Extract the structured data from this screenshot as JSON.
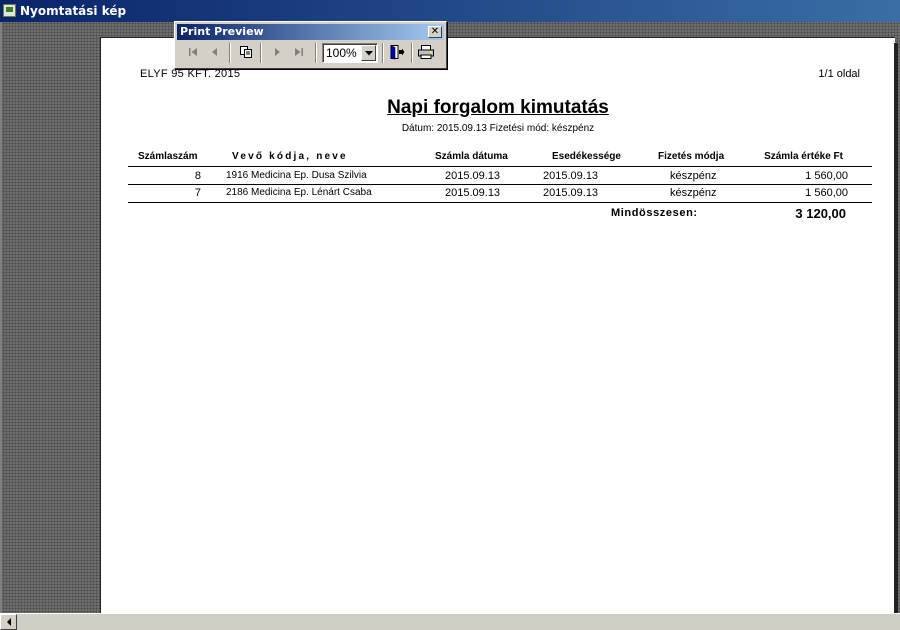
{
  "window": {
    "title": "Nyomtatási kép"
  },
  "toolbar": {
    "title": "Print Preview",
    "close_icon": "close-icon",
    "zoom": "100%",
    "icons": [
      "first-page-icon",
      "prev-page-icon",
      "multi-page-icon",
      "next-page-icon",
      "last-page-icon",
      "chevron-down-icon",
      "exit-icon",
      "printer-icon"
    ]
  },
  "report": {
    "company": "ELYF 95 KFT. 2015",
    "page": "1/1 oldal",
    "title": "Napi forgalom kimutatás",
    "subtitle": "Dátum: 2015.09.13  Fizetési mód: készpénz",
    "headers": {
      "szamlaszam": "Számlaszám",
      "vevo": "Vevő kódja, neve",
      "datum": "Számla dátuma",
      "esedekesseg": "Esedékessége",
      "fizetes": "Fizetés módja",
      "ertek": "Számla értéke Ft"
    },
    "rows": [
      {
        "szamlaszam": "8",
        "vevo": "1916 Medicina Ep. Dusa Szilvia",
        "datum": "2015.09.13",
        "esedekesseg": "2015.09.13",
        "fizetes": "készpénz",
        "ertek": "1 560,00"
      },
      {
        "szamlaszam": "7",
        "vevo": "2186 Medicina Ep. Lénárt Csaba",
        "datum": "2015.09.13",
        "esedekesseg": "2015.09.13",
        "fizetes": "készpénz",
        "ertek": "1 560,00"
      }
    ],
    "total_label": "Mindösszesen:",
    "total_value": "3 120,00"
  }
}
